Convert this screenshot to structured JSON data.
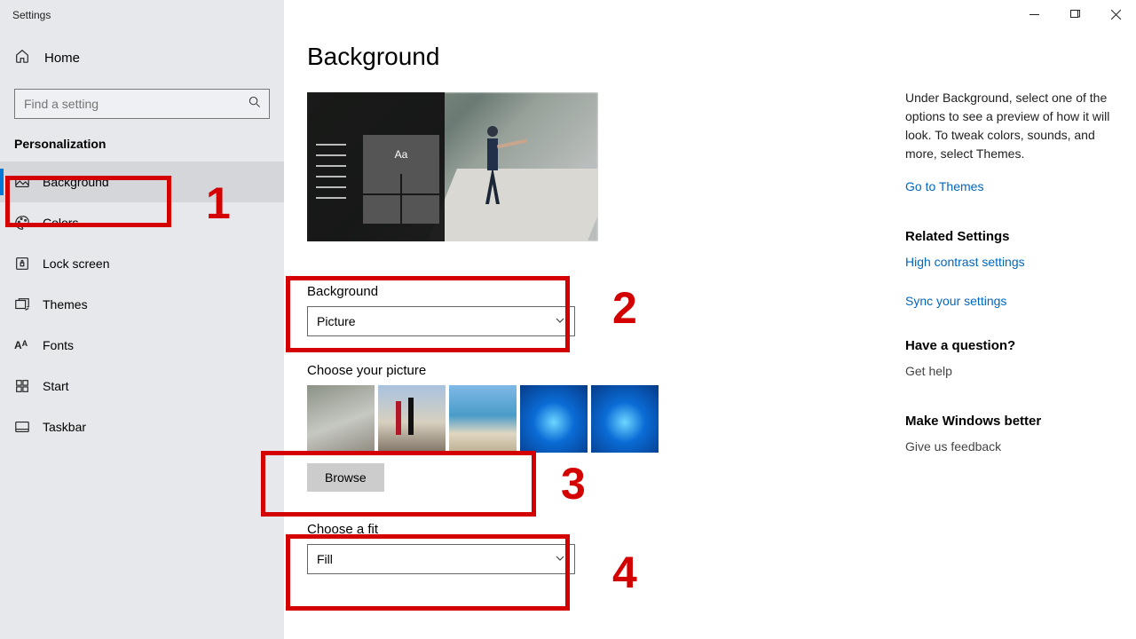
{
  "window": {
    "title": "Settings"
  },
  "sidebar": {
    "home_label": "Home",
    "search_placeholder": "Find a setting",
    "category": "Personalization",
    "items": [
      {
        "label": "Background",
        "icon": "picture-icon",
        "selected": true
      },
      {
        "label": "Colors",
        "icon": "palette-icon",
        "selected": false
      },
      {
        "label": "Lock screen",
        "icon": "lockscreen-icon",
        "selected": false
      },
      {
        "label": "Themes",
        "icon": "themes-icon",
        "selected": false
      },
      {
        "label": "Fonts",
        "icon": "fonts-icon",
        "selected": false
      },
      {
        "label": "Start",
        "icon": "start-icon",
        "selected": false
      },
      {
        "label": "Taskbar",
        "icon": "taskbar-icon",
        "selected": false
      }
    ]
  },
  "main": {
    "title": "Background",
    "preview_aa": "Aa",
    "bg_label": "Background",
    "bg_value": "Picture",
    "choose_picture_label": "Choose your picture",
    "browse_label": "Browse",
    "fit_label": "Choose a fit",
    "fit_value": "Fill"
  },
  "right": {
    "help": "Under Background, select one of the options to see a preview of how it will look. To tweak colors, sounds, and more, select Themes.",
    "themes_link": "Go to Themes",
    "related_heading": "Related Settings",
    "high_contrast": "High contrast settings",
    "sync": "Sync your settings",
    "question_heading": "Have a question?",
    "get_help": "Get help",
    "better_heading": "Make Windows better",
    "feedback": "Give us feedback"
  },
  "annotations": {
    "1": "1",
    "2": "2",
    "3": "3",
    "4": "4"
  }
}
